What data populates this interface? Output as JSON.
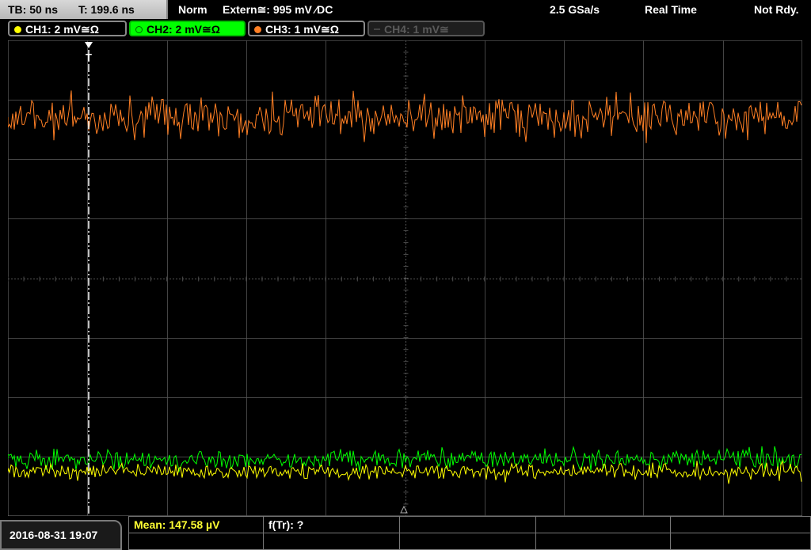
{
  "topbar": {
    "timebase": "TB: 50 ns",
    "trigger_time": "T: 199.6 ns",
    "mode": "Norm",
    "trigger_source": "Extern≅: 995 mV ⁄DC",
    "sample_rate": "2.5 GSa/s",
    "acq_mode": "Real Time",
    "status": "Not Rdy."
  },
  "channels": [
    {
      "label": "CH1: 2 mV≅Ω",
      "color": "#ffff00",
      "state": "on"
    },
    {
      "label": "CH2: 2 mV≅Ω",
      "color": "#00ff00",
      "state": "selected"
    },
    {
      "label": "CH3: 1 mV≅Ω",
      "color": "#ff7f24",
      "state": "on"
    },
    {
      "label": "CH4: 1 mV≅",
      "color": "#5a5a5a",
      "state": "off"
    }
  ],
  "screen": {
    "grid_color": "#555555",
    "trigger_marker": "T",
    "traces": [
      {
        "name": "CH3",
        "color": "#ff7f24"
      },
      {
        "name": "CH2",
        "color": "#00ff00"
      },
      {
        "name": "CH1",
        "color": "#ffff00"
      }
    ]
  },
  "footer": {
    "datetime": "2016-08-31 19:07",
    "measurements": [
      {
        "label": "Mean: 147.58 µV"
      },
      {
        "label": "f(Tr): ?"
      }
    ]
  }
}
